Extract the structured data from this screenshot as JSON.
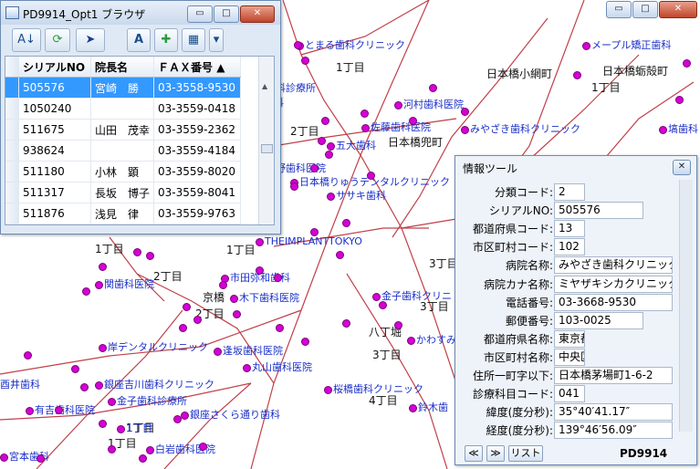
{
  "map": {
    "area_labels": [
      "1丁目",
      "日本橋小網町",
      "日本橋蛎殻町",
      "1丁目",
      "2丁目",
      "日本橋兜町",
      "1丁目",
      "1丁目",
      "2丁目",
      "京橋",
      "2丁目",
      "八丁堀",
      "3丁目",
      "3丁目",
      "4丁目",
      "1丁目",
      "1丁目",
      "3丁目"
    ],
    "clinic_labels": [
      "とまる歯科クリニック",
      "メープル矯正歯科",
      "科診療所",
      "科",
      "河村歯科医院",
      "佐藤歯科医院",
      "みやざき歯科クリニック",
      "五大歯科",
      "塙歯科",
      "野歯科医院",
      "日本橋りゅうデンタルクリニック",
      "ササキ歯科",
      "THEIMPLANTTOKYO",
      "関歯科医院",
      "市田弥和歯科",
      "木下歯科医院",
      "金子歯科クリニ",
      "岸デンタルクリニック",
      "逢坂歯科医院",
      "丸山歯科医院",
      "かわすみ",
      "桜橋歯科クリニック",
      "酉井歯科",
      "銀座吉川歯科クリニック",
      "金子歯科診療所",
      "有吉歯科医院",
      "銀座さくら通り歯科",
      "鈴木歯",
      "1丁目",
      "白岩歯科医院",
      "宮本歯科"
    ]
  },
  "browser": {
    "title": "PD9914_Opt1 ブラウザ",
    "caption": {
      "minimize": "▭",
      "maximize": "□",
      "close": "✕"
    },
    "toolbar": {
      "sort": "A↓",
      "refresh": "⟳",
      "pointer": "➤",
      "font": "A",
      "add": "✚",
      "grid": "▦",
      "dropdown": "▾"
    },
    "columns": [
      "シリアルNO",
      "院長名",
      "ＦＡＸ番号 ▲"
    ],
    "rows": [
      {
        "serial": "505576",
        "director": "宮崎　勝",
        "fax": "03-3558-9530"
      },
      {
        "serial": "1050240",
        "director": "",
        "fax": "03-3559-0418"
      },
      {
        "serial": "511675",
        "director": "山田　茂幸",
        "fax": "03-3559-2362"
      },
      {
        "serial": "938624",
        "director": "",
        "fax": "03-3559-4184"
      },
      {
        "serial": "511180",
        "director": "小林　顕",
        "fax": "03-3559-8020"
      },
      {
        "serial": "511317",
        "director": "長坂　博子",
        "fax": "03-3559-8041"
      },
      {
        "serial": "511876",
        "director": "浅見　律",
        "fax": "03-3559-9763"
      }
    ]
  },
  "main_caption": {
    "minimize": "▭",
    "maximize": "□",
    "close": "✕"
  },
  "info": {
    "title": "情報ツール",
    "close": "✕",
    "fields": [
      {
        "label": "分類コード:",
        "value": "2"
      },
      {
        "label": "シリアルNO:",
        "value": "505576"
      },
      {
        "label": "都道府県コード:",
        "value": "13"
      },
      {
        "label": "市区町村コード:",
        "value": "102"
      },
      {
        "label": "病院名称:",
        "value": "みやざき歯科クリニック"
      },
      {
        "label": "病院カナ名称:",
        "value": "ミヤザキシカクリニック"
      },
      {
        "label": "電話番号:",
        "value": "03-3668-9530"
      },
      {
        "label": "郵便番号:",
        "value": "103-0025"
      },
      {
        "label": "都道府県名称:",
        "value": "東京都"
      },
      {
        "label": "市区町村名称:",
        "value": "中央区"
      },
      {
        "label": "住所一町字以下:",
        "value": "日本橋茅場町1-6-2"
      },
      {
        "label": "診療科目コード:",
        "value": "041"
      },
      {
        "label": "緯度(度分秒):",
        "value": "35°40′41.17″"
      },
      {
        "label": "経度(度分秒):",
        "value": "139°46′56.09″"
      }
    ],
    "nav_prev": "≪",
    "nav_next": "≫",
    "list_button": "リスト",
    "footer": "PD9914"
  },
  "colors": {
    "clinic": "#1a2fc8",
    "pin": "#d400d4",
    "road": "#c0404a",
    "selection": "#3399ff"
  }
}
